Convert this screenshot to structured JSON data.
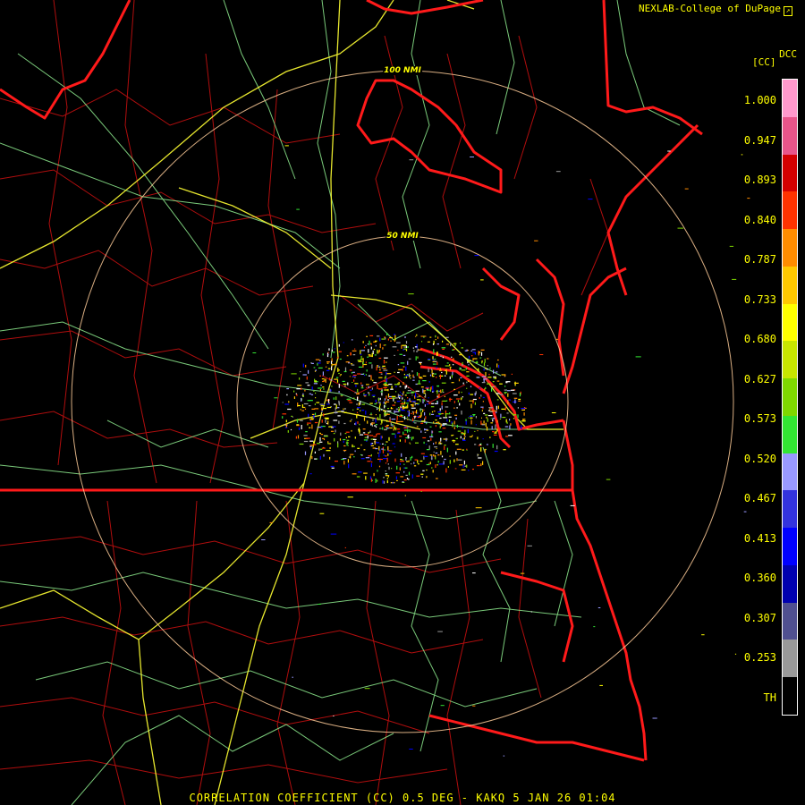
{
  "credit": "NEXLAB-College of DuPage",
  "legend": {
    "product": "DCC",
    "unit": "[CC]",
    "ticks": [
      "1.000",
      "0.947",
      "0.893",
      "0.840",
      "0.787",
      "0.733",
      "0.680",
      "0.627",
      "0.573",
      "0.520",
      "0.467",
      "0.413",
      "0.360",
      "0.307",
      "0.253",
      "TH"
    ],
    "colors": [
      "#ff99cc",
      "#e8558a",
      "#d40000",
      "#ff3300",
      "#ff8c00",
      "#ffc800",
      "#ffff00",
      "#c8e600",
      "#7fd800",
      "#33e633",
      "#9999ff",
      "#3333dd",
      "#0000ff",
      "#0000b0",
      "#505090",
      "#9a9a9a",
      "#000000"
    ]
  },
  "range_rings": [
    "100 NMI",
    "50 NMI"
  ],
  "footer": "CORRELATION COEFFICIENT (CC) 0.5 DEG - KAKQ 5 JAN 26 01:04",
  "colors": {
    "state_border": "#ff0000",
    "county_border": "#cc1010",
    "highway_primary": "#ffff00",
    "highway_secondary": "#90ee90",
    "range_ring": "#ffcc99"
  }
}
